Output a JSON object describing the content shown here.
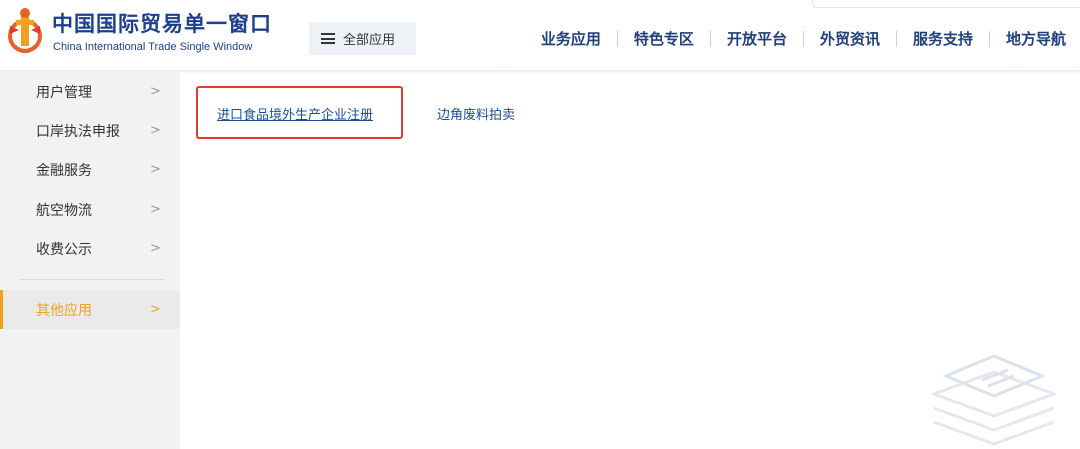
{
  "header": {
    "brand_cn": "中国国际贸易单一窗口",
    "brand_en": "China International Trade Single Window",
    "all_apps_label": "全部应用",
    "nav": [
      "业务应用",
      "特色专区",
      "开放平台",
      "外贸资讯",
      "服务支持",
      "地方导航"
    ]
  },
  "sidebar": {
    "items": [
      {
        "label": "用户管理",
        "arrow": ">"
      },
      {
        "label": "口岸执法申报",
        "arrow": ">"
      },
      {
        "label": "金融服务",
        "arrow": ">"
      },
      {
        "label": "航空物流",
        "arrow": ">"
      },
      {
        "label": "收费公示",
        "arrow": ">"
      }
    ],
    "active_item": {
      "label": "其他应用",
      "arrow": ">"
    }
  },
  "content": {
    "links": [
      "进口食品境外生产企业注册",
      "边角废料拍卖"
    ]
  },
  "colors": {
    "brand_blue": "#1d3f8f",
    "nav_blue": "#1f3f7d",
    "active_orange": "#f0a11d",
    "highlight_red": "#e23b2e"
  }
}
